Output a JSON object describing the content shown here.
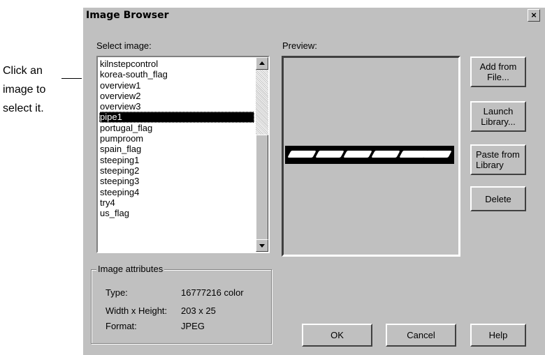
{
  "annotation": {
    "line1": "Click an",
    "line2": "image to",
    "line3": "select it."
  },
  "dialog": {
    "title": "Image Browser",
    "close_label": "×",
    "select_label": "Select image:",
    "preview_label": "Preview:",
    "images": [
      "kilnstepcontrol",
      "korea-south_flag",
      "overview1",
      "overview2",
      "overview3",
      "pipe1",
      "portugal_flag",
      "pumproom",
      "spain_flag",
      "steeping1",
      "steeping2",
      "steeping3",
      "steeping4",
      "try4",
      "us_flag"
    ],
    "selected_image": "pipe1",
    "buttons": {
      "add_from_file": "Add from\nFile...",
      "launch_library": "Launch\nLibrary...",
      "paste_from_library": "Paste from\nLibrary",
      "delete": "Delete",
      "ok": "OK",
      "cancel": "Cancel",
      "help": "Help"
    },
    "attributes": {
      "group_title": "Image attributes",
      "type_label": "Type:",
      "type_value": "16777216 color",
      "size_label": "Width x Height:",
      "size_value": "203 x 25",
      "format_label": "Format:",
      "format_value": "JPEG"
    }
  }
}
